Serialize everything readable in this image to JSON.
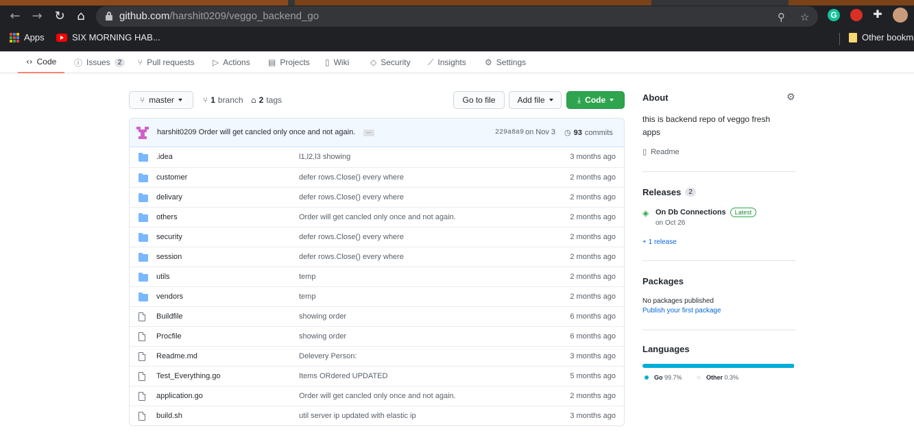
{
  "browser": {
    "url_host": "github.com",
    "url_path": "/harshit0209/veggo_backend_go",
    "extensions": [
      {
        "name": "grammarly-icon",
        "letter": "G",
        "color": "#15c39a"
      },
      {
        "name": "santa-extension-icon",
        "letter": "",
        "color": "#d93025"
      }
    ],
    "bookmarks": {
      "apps": "Apps",
      "item1": "SIX MORNING HAB...",
      "other": "Other bookmarks"
    }
  },
  "repo_nav": [
    {
      "name": "tab-code",
      "icon": "<>",
      "label": "Code",
      "selected": true
    },
    {
      "name": "tab-issues",
      "icon": "ⓘ",
      "label": "Issues",
      "count": "2"
    },
    {
      "name": "tab-pull-requests",
      "icon": "⑂",
      "label": "Pull requests"
    },
    {
      "name": "tab-actions",
      "icon": "▷",
      "label": "Actions"
    },
    {
      "name": "tab-projects",
      "icon": "▤",
      "label": "Projects"
    },
    {
      "name": "tab-wiki",
      "icon": "▯",
      "label": "Wiki"
    },
    {
      "name": "tab-security",
      "icon": "◇",
      "label": "Security"
    },
    {
      "name": "tab-insights",
      "icon": "⟋",
      "label": "Insights"
    },
    {
      "name": "tab-settings",
      "icon": "⚙",
      "label": "Settings"
    }
  ],
  "toolbar": {
    "branch": "master",
    "branch_count": "1",
    "branch_label": "branch",
    "tag_count": "2",
    "tag_label": "tags",
    "go_to_file": "Go to file",
    "add_file": "Add file",
    "code": "Code"
  },
  "latest_commit": {
    "author": "harshit0209",
    "message": "Order will get cancled only once and not again.",
    "ellipsis": "...",
    "hash": "229a8a9",
    "date": "on Nov 3",
    "commit_count": "93",
    "commit_label": "commits"
  },
  "files": [
    {
      "type": "dir",
      "name": ".idea",
      "message": "l1,l2,l3 showing",
      "age": "3 months ago"
    },
    {
      "type": "dir",
      "name": "customer",
      "message": "defer rows.Close() every where",
      "age": "2 months ago"
    },
    {
      "type": "dir",
      "name": "delivary",
      "message": "defer rows.Close() every where",
      "age": "2 months ago"
    },
    {
      "type": "dir",
      "name": "others",
      "message": "Order will get cancled only once and not again.",
      "age": "2 months ago"
    },
    {
      "type": "dir",
      "name": "security",
      "message": "defer rows.Close() every where",
      "age": "2 months ago"
    },
    {
      "type": "dir",
      "name": "session",
      "message": "defer rows.Close() every where",
      "age": "2 months ago"
    },
    {
      "type": "dir",
      "name": "utils",
      "message": "temp",
      "age": "2 months ago"
    },
    {
      "type": "dir",
      "name": "vendors",
      "message": "temp",
      "age": "2 months ago"
    },
    {
      "type": "file",
      "name": "Buildfile",
      "message": "showing order",
      "age": "6 months ago"
    },
    {
      "type": "file",
      "name": "Procfile",
      "message": "showing order",
      "age": "6 months ago"
    },
    {
      "type": "file",
      "name": "Readme.md",
      "message": "Delevery Person:",
      "age": "3 months ago"
    },
    {
      "type": "file",
      "name": "Test_Everything.go",
      "message": "Items ORdered UPDATED",
      "age": "5 months ago"
    },
    {
      "type": "file",
      "name": "application.go",
      "message": "Order will get cancled only once and not again.",
      "age": "2 months ago"
    },
    {
      "type": "file",
      "name": "build.sh",
      "message": "util server ip updated with elastic ip",
      "age": "3 months ago"
    }
  ],
  "sidebar": {
    "about_title": "About",
    "description": "this is backend repo of veggo fresh apps",
    "readme": "Readme",
    "releases_title": "Releases",
    "releases_count": "2",
    "release_name": "On Db Connections",
    "release_badge": "Latest",
    "release_date": "on Oct 26",
    "more_releases": "+ 1 release",
    "packages_title": "Packages",
    "packages_empty": "No packages published",
    "packages_link": "Publish your first package",
    "languages_title": "Languages",
    "languages": [
      {
        "name": "Go",
        "percent": "99.7%",
        "value": 99.7,
        "color": "#00add8"
      },
      {
        "name": "Other",
        "percent": "0.3%",
        "value": 0.3,
        "color": "#ededed"
      }
    ]
  }
}
